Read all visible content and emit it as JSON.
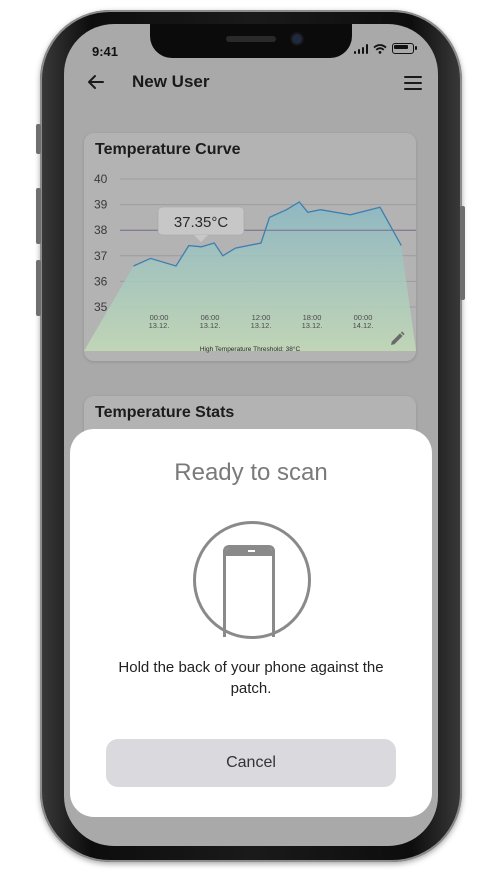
{
  "status_bar": {
    "time": "9:41"
  },
  "app_bar": {
    "title": "New User"
  },
  "temperature_curve": {
    "title": "Temperature Curve",
    "tooltip": "37.35°C",
    "threshold_label": "High Temperature Threshold: 38°C",
    "chart_data": {
      "type": "area",
      "title": "Temperature Curve",
      "y_ticks": [
        "40",
        "39",
        "38",
        "37",
        "36",
        "35"
      ],
      "ylim": [
        35,
        40
      ],
      "threshold": 38,
      "x_ticks": [
        {
          "time": "00:00",
          "date": "13.12."
        },
        {
          "time": "06:00",
          "date": "13.12."
        },
        {
          "time": "12:00",
          "date": "13.12."
        },
        {
          "time": "18:00",
          "date": "13.12."
        },
        {
          "time": "00:00",
          "date": "14.12."
        }
      ],
      "series": [
        {
          "values": [
            [
              -3.0,
              36.6
            ],
            [
              -1.0,
              36.9
            ],
            [
              2.0,
              36.6
            ],
            [
              3.5,
              37.4
            ],
            [
              5.0,
              37.35
            ],
            [
              6.5,
              37.5
            ],
            [
              7.5,
              37.0
            ],
            [
              9.0,
              37.3
            ],
            [
              12.0,
              37.5
            ],
            [
              13.0,
              38.5
            ],
            [
              15.0,
              38.8
            ],
            [
              16.5,
              39.1
            ],
            [
              17.5,
              38.7
            ],
            [
              19.0,
              38.8
            ],
            [
              22.5,
              38.6
            ],
            [
              26.0,
              38.9
            ],
            [
              28.5,
              37.4
            ]
          ]
        }
      ],
      "grid": true,
      "colors": {
        "line": "#3f7fb0",
        "fill_top": "#8ab8c4",
        "fill_bottom": "#c3dbb7",
        "threshold": "#7d6f8e"
      }
    }
  },
  "temperature_stats": {
    "title": "Temperature Stats"
  },
  "scan_sheet": {
    "title": "Ready to scan",
    "message": "Hold the back of your phone against the patch.",
    "cancel_label": "Cancel"
  },
  "icons": {
    "back": "back-arrow-icon",
    "menu": "hamburger-menu-icon",
    "edit": "pencil-icon",
    "scan": "phone-scan-icon",
    "signal": "signal-icon",
    "wifi": "wifi-icon",
    "battery": "battery-icon"
  }
}
